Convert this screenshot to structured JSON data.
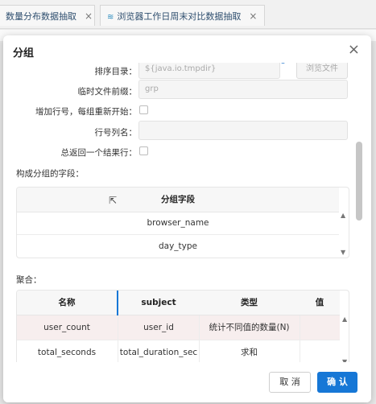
{
  "background_tabs": [
    {
      "label": "数量分布数据抽取"
    },
    {
      "label": "浏览器工作日周末对比数据抽取"
    }
  ],
  "dialog": {
    "title": "分组",
    "close_label": "×"
  },
  "form": {
    "sort_dir_label": "排序目录：",
    "sort_dir_value": "${java.io.tmpdir}",
    "browse_label": "浏览文件",
    "temp_prefix_label": "临时文件前缀：",
    "temp_prefix_value": "grp",
    "add_row_label": "增加行号，每组重新开始：",
    "row_col_label": "行号列名：",
    "row_col_value": "",
    "always_one_label": "总返回一个结果行："
  },
  "group_section": {
    "title": "构成分组的字段：",
    "header": "分组字段",
    "rows": [
      "browser_name",
      "day_type"
    ]
  },
  "agg_section": {
    "title": "聚合：",
    "headers": [
      "名称",
      "subject",
      "类型",
      "值"
    ],
    "rows": [
      {
        "name": "user_count",
        "subject": "user_id",
        "type": "统计不同值的数量(N)",
        "value": ""
      },
      {
        "name": "total_seconds",
        "subject": "total_duration_sec",
        "type": "求和",
        "value": ""
      }
    ]
  },
  "footer": {
    "cancel_label": "取 消",
    "ok_label": "确 认"
  },
  "colors": {
    "primary": "#1677d6",
    "selected_row": "#f7eeee"
  }
}
